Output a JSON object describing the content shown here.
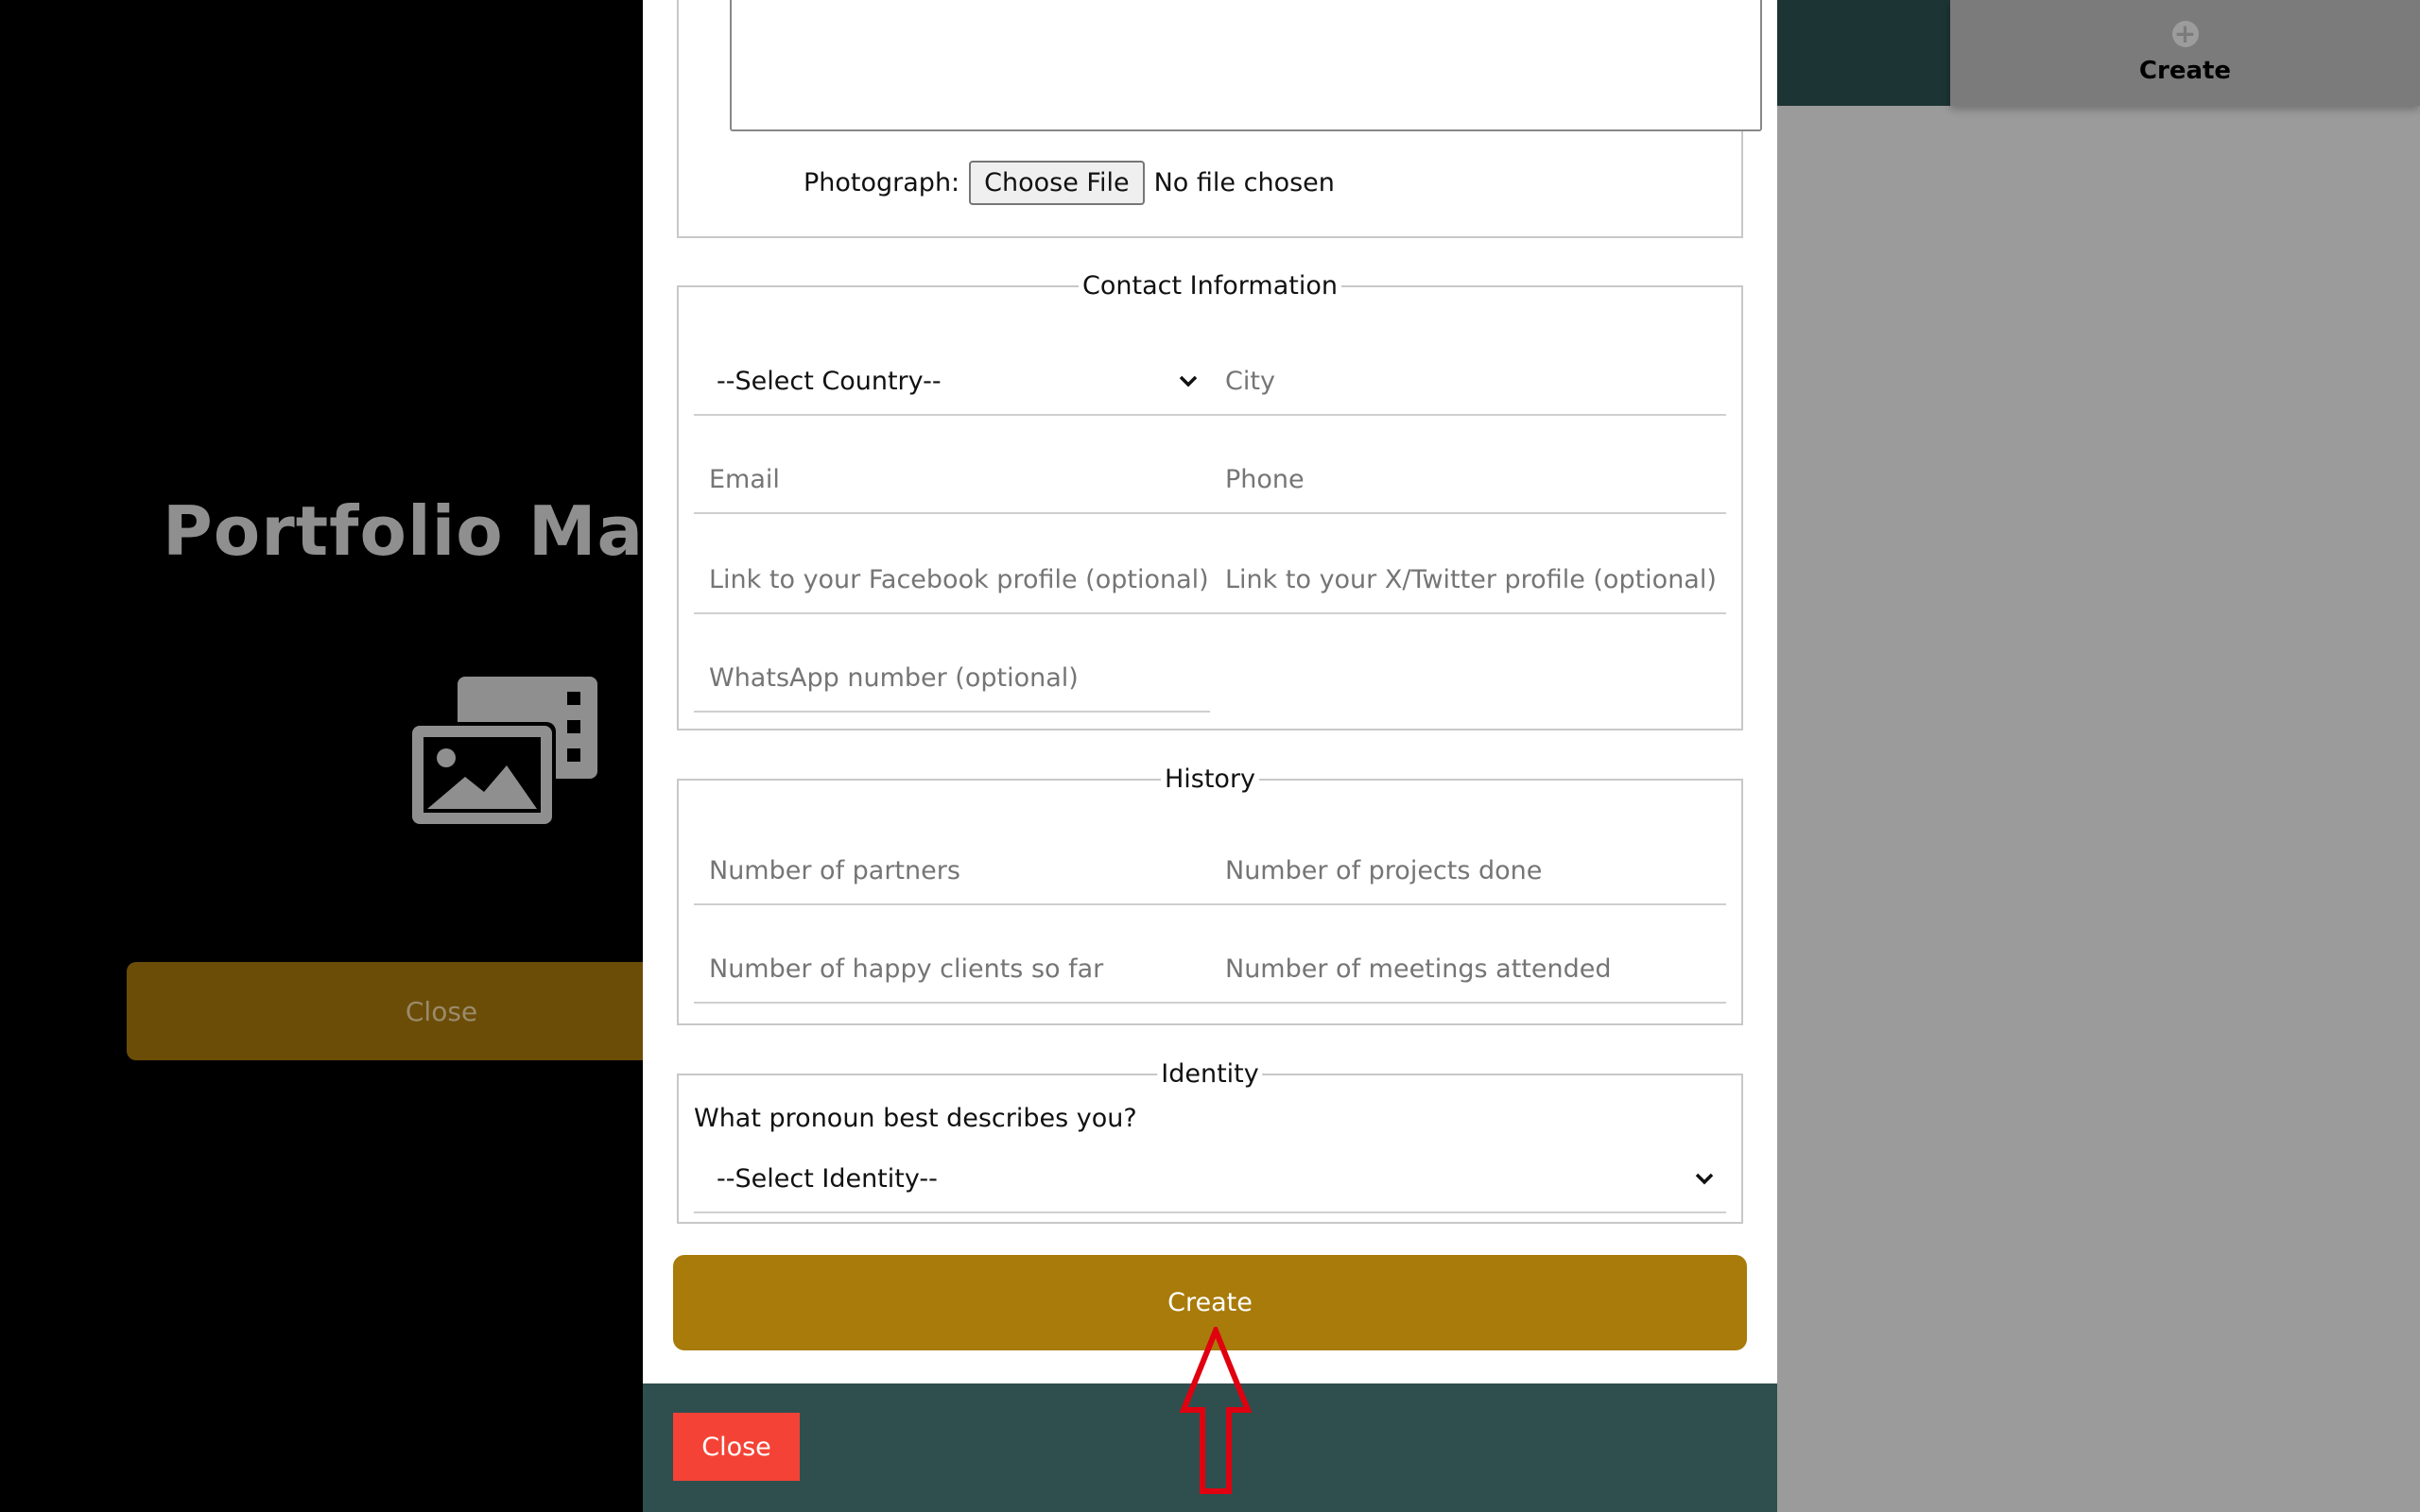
{
  "background": {
    "title": "Portfolio Mar",
    "close_label": "Close",
    "nav_create_label": "Create",
    "media_icon": "photo-film-icon"
  },
  "modal": {
    "photo_label": "Photograph:",
    "choose_file_label": "Choose File",
    "no_file_text": "No file chosen",
    "contact": {
      "legend": "Contact Information",
      "country_value": "--Select Country--",
      "city_placeholder": "City",
      "email_placeholder": "Email",
      "phone_placeholder": "Phone",
      "facebook_placeholder": "Link to your Facebook profile (optional)",
      "twitter_placeholder": "Link to your X/Twitter profile (optional)",
      "whatsapp_placeholder": "WhatsApp number (optional)"
    },
    "history": {
      "legend": "History",
      "partners_placeholder": "Number of partners",
      "projects_placeholder": "Number of projects done",
      "clients_placeholder": "Number of happy clients so far",
      "meetings_placeholder": "Number of meetings attended"
    },
    "identity": {
      "legend": "Identity",
      "question": "What pronoun best describes you?",
      "select_value": "--Select Identity--"
    },
    "create_label": "Create",
    "footer_close_label": "Close"
  },
  "colors": {
    "create_button": "#a87b0a",
    "footer": "#2f4f4e",
    "close_button": "#f44336",
    "annotation_arrow": "#e0000f"
  }
}
